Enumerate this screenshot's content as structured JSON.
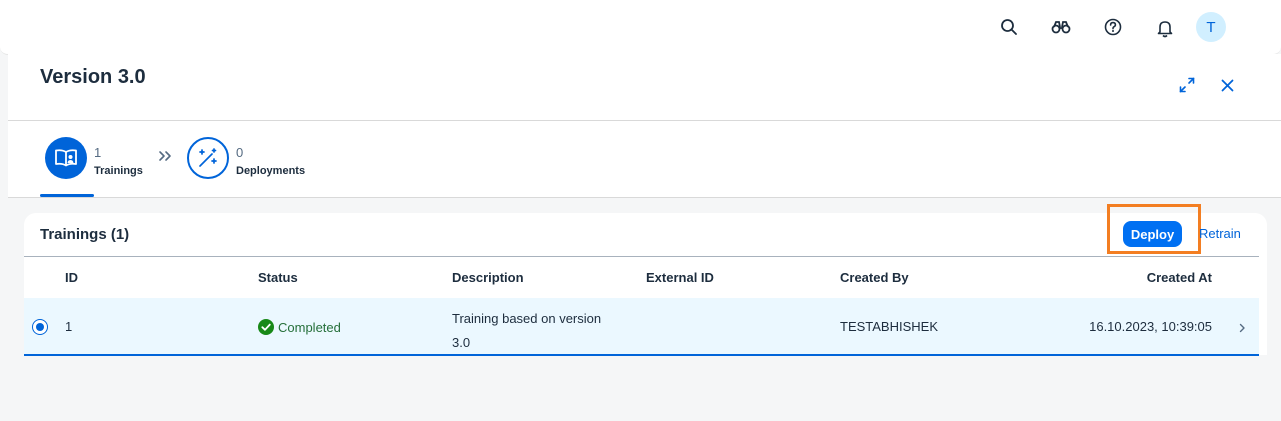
{
  "shellbar": {
    "icons": [
      "search-icon",
      "binoculars-icon",
      "help-icon",
      "bell-icon"
    ],
    "avatar_initial": "T"
  },
  "panel": {
    "title": "Version 3.0",
    "header_actions": [
      "fullscreen-icon",
      "close-icon"
    ]
  },
  "steps": [
    {
      "count": "1",
      "label": "Trainings",
      "icon": "book-icon",
      "selected": true
    },
    {
      "count": "0",
      "label": "Deployments",
      "icon": "magic-wand-icon",
      "selected": false
    }
  ],
  "trainings": {
    "title": "Trainings (1)",
    "deploy_label": "Deploy",
    "retrain_label": "Retrain",
    "columns": {
      "id": "ID",
      "status": "Status",
      "description": "Description",
      "external_id": "External ID",
      "created_by": "Created By",
      "created_at": "Created At"
    },
    "rows": [
      {
        "id": "1",
        "status": "Completed",
        "description_line1": "Training based on version",
        "description_line2": "3.0",
        "external_id": "",
        "created_by": "TESTABHISHEK",
        "created_at": "16.10.2023, 10:39:05"
      }
    ]
  },
  "colors": {
    "accent": "#0070f2",
    "success": "#188918",
    "highlight": "#f37e22",
    "selected_row": "#ebf8ff"
  }
}
